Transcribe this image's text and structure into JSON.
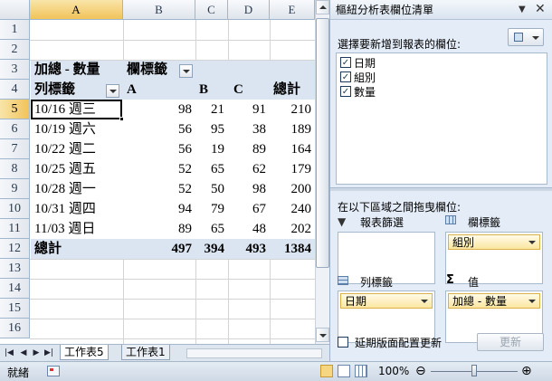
{
  "columns": [
    "A",
    "B",
    "C",
    "D",
    "E"
  ],
  "rows": [
    "1",
    "2",
    "3",
    "4",
    "5",
    "6",
    "7",
    "8",
    "9",
    "10",
    "11",
    "12",
    "13",
    "14",
    "15",
    "16"
  ],
  "pivot": {
    "header_label": "加總 - 數量",
    "col_label": "欄標籤",
    "row_label": "列標籤",
    "col_categories": [
      "A",
      "B",
      "C"
    ],
    "total_label": "總計",
    "data": [
      {
        "label": "10/16 週三",
        "a": "98",
        "b": "21",
        "c": "91",
        "t": "210"
      },
      {
        "label": "10/19 週六",
        "a": "56",
        "b": "95",
        "c": "38",
        "t": "189"
      },
      {
        "label": "10/22 週二",
        "a": "56",
        "b": "19",
        "c": "89",
        "t": "164"
      },
      {
        "label": "10/25 週五",
        "a": "52",
        "b": "65",
        "c": "62",
        "t": "179"
      },
      {
        "label": "10/28 週一",
        "a": "52",
        "b": "50",
        "c": "98",
        "t": "200"
      },
      {
        "label": "10/31 週四",
        "a": "94",
        "b": "79",
        "c": "67",
        "t": "240"
      },
      {
        "label": "11/03 週日",
        "a": "89",
        "b": "65",
        "c": "48",
        "t": "202"
      }
    ],
    "grand": {
      "label": "總計",
      "a": "497",
      "b": "394",
      "c": "493",
      "t": "1384"
    }
  },
  "sheets": [
    "工作表5",
    "工作表1"
  ],
  "status": {
    "ready": "就緒",
    "zoom": "100%"
  },
  "pane": {
    "title": "樞紐分析表欄位清單",
    "choose_label": "選擇要新增到報表的欄位:",
    "fields": [
      "日期",
      "組別",
      "數量"
    ],
    "drag_label": "在以下區域之間拖曳欄位:",
    "filter_label": "報表篩選",
    "columns_label": "欄標籤",
    "columns_chip": "組別",
    "rows_label": "列標籤",
    "rows_chip": "日期",
    "values_label": "值",
    "values_chip": "加總 - 數量",
    "defer_label": "延期版面配置更新",
    "update_label": "更新"
  },
  "colors": {
    "pivot_band": "#dbe5f1",
    "selection": "#f1c35a",
    "pane_bg": "#e4ecf7"
  }
}
